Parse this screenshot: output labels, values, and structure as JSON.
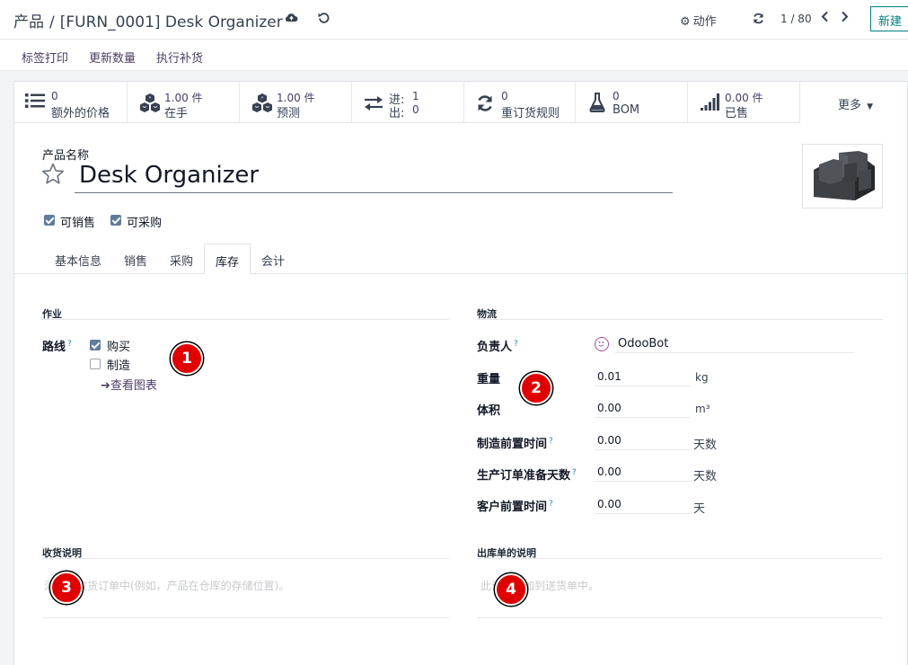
{
  "breadcrumb": {
    "root": "产品",
    "separator": "/",
    "current": "[FURN_0001] Desk Organizer"
  },
  "control_panel": {
    "action_label": "动作",
    "pager_value": "1 / 80",
    "new_label": "新建"
  },
  "action_bar": {
    "print_labels": "标签打印",
    "update_qty": "更新数量",
    "replenish": "执行补货"
  },
  "smart_buttons": [
    {
      "value": "0",
      "label": "额外的价格",
      "icon": "list-icon"
    },
    {
      "value": "1.00 件",
      "label": "在手",
      "icon": "cubes-icon"
    },
    {
      "value": "1.00 件",
      "label": "预测",
      "icon": "cubes-icon"
    },
    {
      "in_label": "进:",
      "in_value": "1",
      "out_label": "出:",
      "out_value": "0",
      "icon": "exchange-icon"
    },
    {
      "value": "0",
      "label": "重订货规则",
      "icon": "refresh-icon"
    },
    {
      "value": "0",
      "label": "BOM",
      "icon": "flask-icon"
    },
    {
      "value": "0.00 件",
      "label": "已售",
      "icon": "signal-icon"
    }
  ],
  "more_label": "更多",
  "product": {
    "name_label": "产品名称",
    "name": "Desk Organizer",
    "can_be_sold_label": "可销售",
    "can_be_purchased_label": "可采购",
    "can_be_sold": true,
    "can_be_purchased": true
  },
  "tabs": [
    "基本信息",
    "销售",
    "采购",
    "库存",
    "会计"
  ],
  "active_tab": "库存",
  "operations": {
    "title": "作业",
    "routes_label": "路线",
    "routes": [
      {
        "label": "购买",
        "checked": true
      },
      {
        "label": "制造",
        "checked": false
      }
    ],
    "view_diagram": "查看图表"
  },
  "logistics": {
    "title": "物流",
    "responsible_label": "负责人",
    "responsible": "OdooBot",
    "weight_label": "重量",
    "weight": "0.01",
    "weight_unit": "kg",
    "volume_label": "体积",
    "volume": "0.00",
    "volume_unit": "m³",
    "mfg_lead_label": "制造前置时间",
    "mfg_lead": "0.00",
    "mfg_lead_unit": "天数",
    "days_to_prepare_label": "生产订单准备天数",
    "days_to_prepare": "0.00",
    "days_to_prepare_unit": "天数",
    "customer_lead_label": "客户前置时间",
    "customer_lead": "0.00",
    "customer_lead_unit": "天"
  },
  "receipt_notes": {
    "title": "收货说明",
    "placeholder": "添加到收货订单中(例如，产品在仓库的存储位置)。"
  },
  "delivery_notes": {
    "title": "出库单的说明",
    "placeholder": "此说明添加到送货单中。"
  },
  "badges": [
    "1",
    "2",
    "3",
    "4"
  ],
  "colors": {
    "accent": "#017e84",
    "link": "#4b3c66",
    "badge": "#e00000",
    "checkbox": "#5f7c9a"
  }
}
